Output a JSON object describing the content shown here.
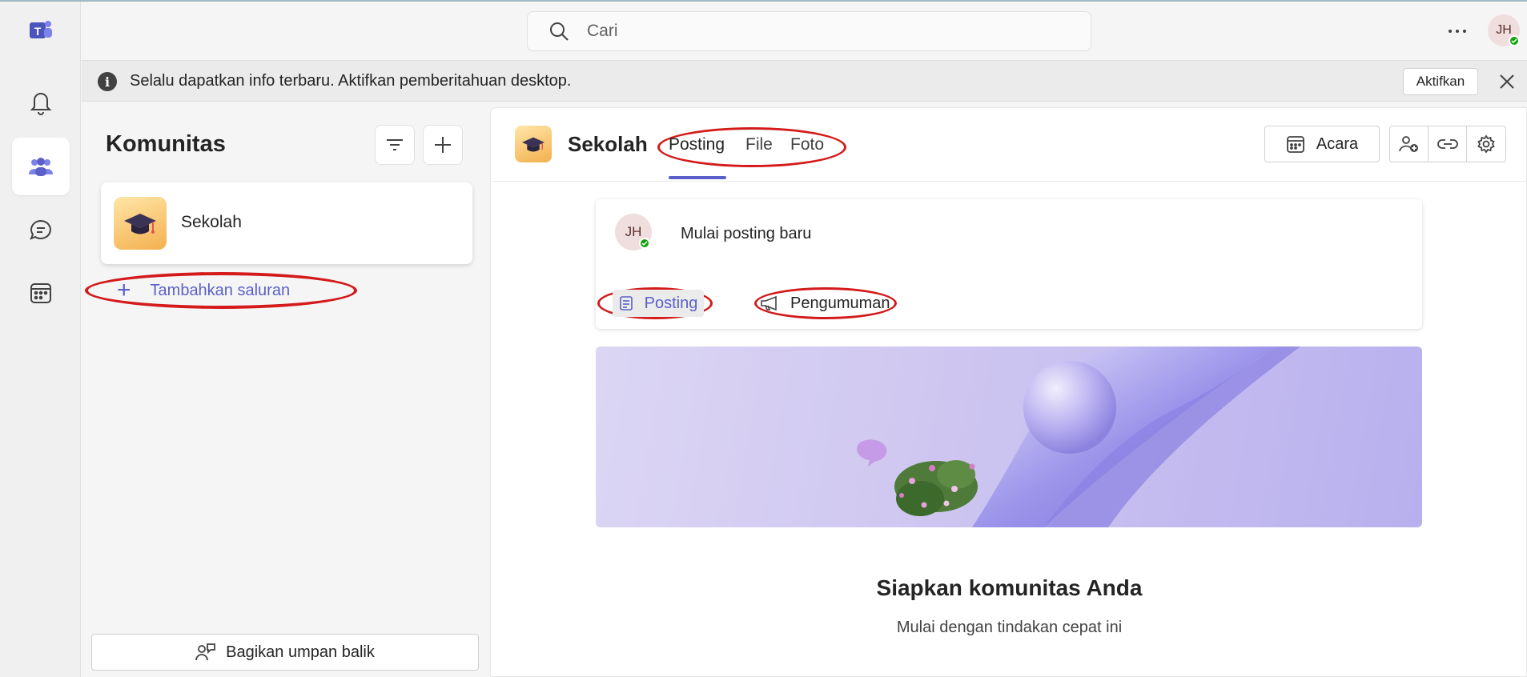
{
  "search": {
    "placeholder": "Cari"
  },
  "user": {
    "initials": "JH"
  },
  "notification": {
    "message": "Selalu dapatkan info terbaru. Aktifkan pemberitahuan desktop.",
    "action_label": "Aktifkan"
  },
  "sidebar": {
    "title": "Komunitas",
    "team": {
      "name": "Sekolah"
    },
    "add_channel_label": "Tambahkan saluran",
    "feedback_label": "Bagikan umpan balik"
  },
  "channel": {
    "name": "Sekolah",
    "tabs": [
      {
        "label": "Posting"
      },
      {
        "label": "File"
      },
      {
        "label": "Foto"
      }
    ],
    "events_label": "Acara"
  },
  "composer": {
    "prompt": "Mulai posting baru",
    "post_label": "Posting",
    "announcement_label": "Pengumuman"
  },
  "setup": {
    "title": "Siapkan komunitas Anda",
    "subtitle": "Mulai dengan tindakan cepat ini"
  },
  "colors": {
    "accent": "#5b5fc7",
    "annotation_red": "#d41a1a",
    "presence_green": "#13a10e"
  }
}
